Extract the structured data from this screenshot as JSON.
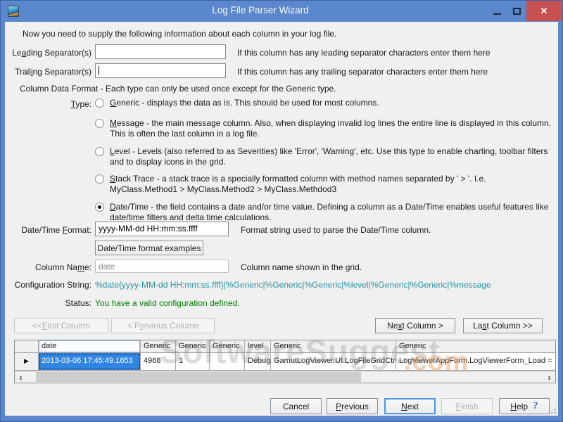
{
  "colors": {
    "titlebar_blue": "#5b87cd",
    "close_button_red": "#c75050",
    "config_string_teal": "#2792a2",
    "status_green": "#008000",
    "grid_selection_blue": "#3186e3",
    "focus_border_blue": "#4a97e8",
    "watermark_gray": "#828282",
    "watermark_orange": "#e89650"
  },
  "window": {
    "title": "Log File Parser Wizard",
    "close_glyph": "✕"
  },
  "intro": "Now you need to supply the following information about each column in your log file.",
  "separators": {
    "leading_label": "Leading Separator(s)",
    "leading_value": "",
    "leading_hint": "If this column has any leading separator characters enter them here",
    "trailing_label": "Trailing Separator(s)",
    "trailing_value": "",
    "trailing_hint": "If this column has any trailing separator characters enter them here"
  },
  "format_section": {
    "heading": "Column Data Format - Each type can only be used once except for the Generic type.",
    "type_label": "Type:",
    "options": [
      {
        "label": "Generic - displays the data as is. This should be used for most columns.",
        "selected": false
      },
      {
        "label": "Message - the main message column. Also, when displaying invalid log lines the entire line is displayed in this column. This is often the last column in a log file.",
        "selected": false
      },
      {
        "label": "Level - Levels (also referred to as Severities) like 'Error', 'Warning', etc. Use this type to enable charting, toolbar filters and to display icons in the grid.",
        "selected": false
      },
      {
        "label": "Stack Trace - a stack trace is a specially formatted column with method names separated by ' > '. I.e. MyClass.Method1 > MyClass.Method2 > MyClass.Methdod3",
        "selected": false
      },
      {
        "label": "Date/Time - the field contains a date and/or time value. Defining a column as a Date/Time enables useful features like date/time filters and delta time calculations.",
        "selected": true
      }
    ]
  },
  "datetime_format": {
    "label": "Date/Time Format:",
    "value": "yyyy-MM-dd HH:mm:ss.ffff",
    "hint": "Format string used to parse the Date/Time column.",
    "examples_button": "Date/Time format examples"
  },
  "column_name": {
    "label": "Column Name:",
    "value": "date",
    "hint": "Column name shown in the grid."
  },
  "config": {
    "label": "Configuration String:",
    "value": "%date{yyyy-MM-dd HH:mm:ss.ffff}|%Generic|%Generic|%Generic|%level|%Generic|%Generic|%message"
  },
  "status": {
    "label": "Status:",
    "value": "You have a valid configuration defined."
  },
  "column_nav": {
    "first": "<< First Column",
    "previous": "< Previous Column",
    "next": "Next Column >",
    "last": "Last Column >>"
  },
  "grid": {
    "headers": [
      "date",
      "Generic",
      "Generic",
      "Generic",
      "level",
      "Generic",
      "Generic"
    ],
    "row": [
      "2013-03-06 17:45:49.1653",
      "4968",
      "1",
      "",
      "Debug",
      "GamutLogViewer.UI.LogFileGridCtrl",
      "LogViewerAppForm.LogViewerForm_Load ="
    ]
  },
  "watermark": {
    "text": "SoftwareSuggest",
    "suffix": ".com"
  },
  "buttons": {
    "cancel": "Cancel",
    "previous": "Previous",
    "next": "Next",
    "finish": "Finish",
    "help": "Help",
    "help_icon": "?"
  }
}
